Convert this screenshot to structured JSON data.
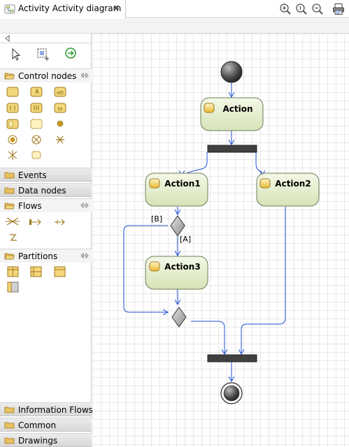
{
  "tab": {
    "title": "Activity Activity diagram",
    "close_glyph": "✖"
  },
  "toolbar": {
    "icons": [
      "zoom-in-icon",
      "zoom-actual-icon",
      "zoom-out-icon",
      "print-icon"
    ]
  },
  "palette": {
    "tools": [
      "select-arrow-icon",
      "marquee-select-icon",
      "connection-icon"
    ],
    "drawers": {
      "control_nodes": "Control nodes",
      "events": "Events",
      "data_nodes": "Data nodes",
      "flows": "Flows",
      "partitions": "Partitions",
      "information_flows": "Information Flows",
      "common": "Common",
      "drawings": "Drawings"
    }
  },
  "diagram": {
    "actions": {
      "action": "Action",
      "action1": "Action1",
      "action2": "Action2",
      "action3": "Action3"
    },
    "guards": {
      "b": "[B]",
      "a": "[A]"
    },
    "colors": {
      "flow": "#1f4fd6",
      "action_fill_top": "#f4f8e8",
      "action_fill_bottom": "#d6e3b6",
      "action_border": "#6e7e5a",
      "bar": "#404040",
      "grid": "#e8e8e8"
    }
  }
}
